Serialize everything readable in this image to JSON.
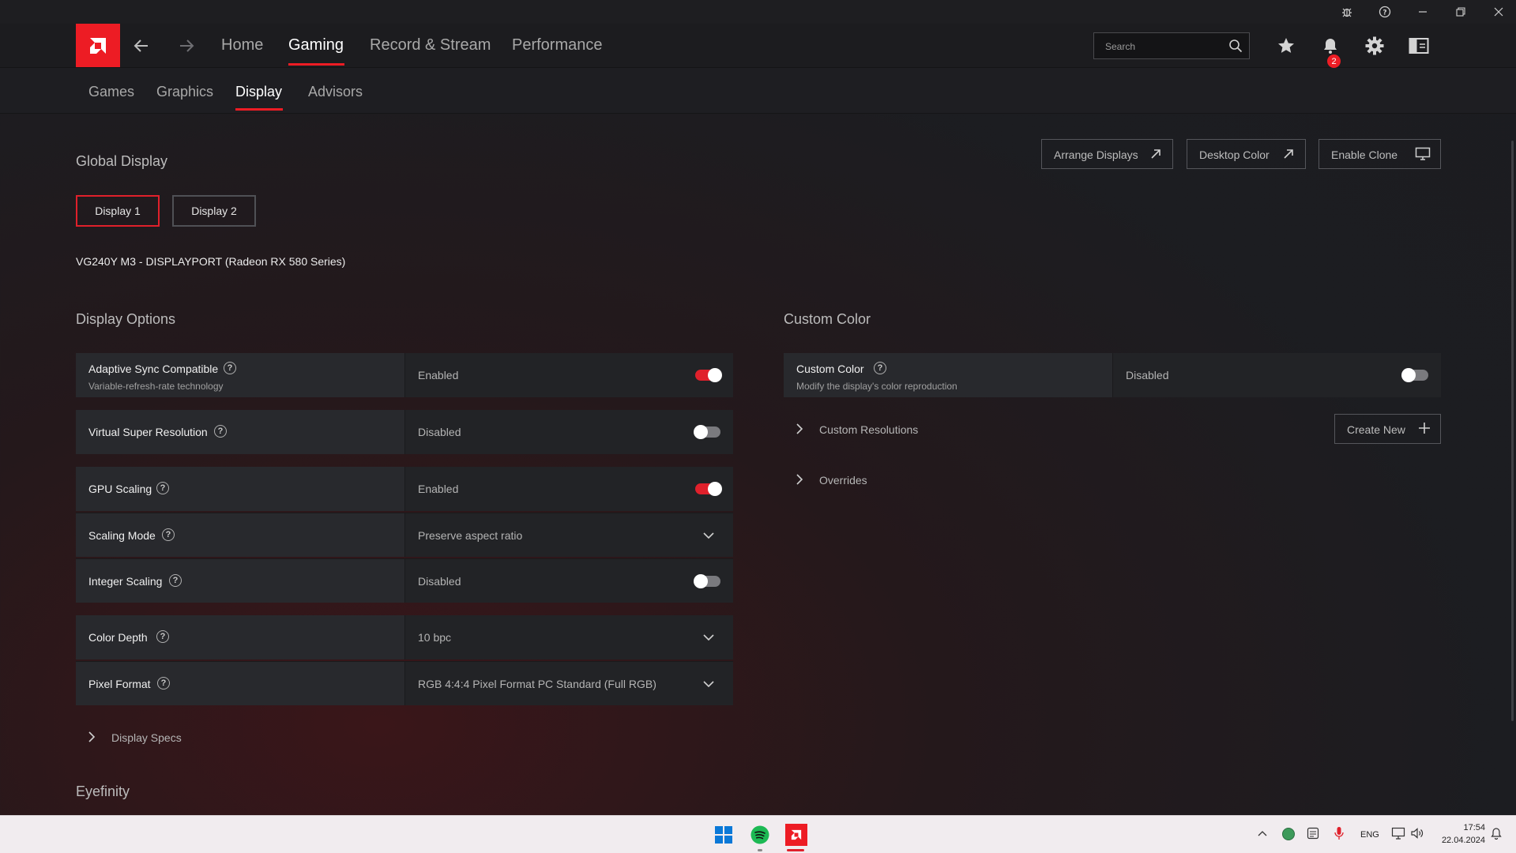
{
  "app": {
    "title_bar_icons": [
      "bug-icon",
      "help-icon",
      "minimize-icon",
      "restore-icon",
      "close-icon"
    ]
  },
  "nav": {
    "back_icon": "arrow-left-icon",
    "forward_icon": "arrow-right-icon",
    "items": [
      {
        "label": "Home",
        "active": false
      },
      {
        "label": "Gaming",
        "active": true
      },
      {
        "label": "Record & Stream",
        "active": false
      },
      {
        "label": "Performance",
        "active": false
      }
    ],
    "search_placeholder": "Search",
    "notification_count": "2",
    "header_icons": [
      "star-icon",
      "bell-icon",
      "gear-icon",
      "sidebar-panel-icon"
    ]
  },
  "subnav": {
    "items": [
      {
        "label": "Games",
        "active": false
      },
      {
        "label": "Graphics",
        "active": false
      },
      {
        "label": "Display",
        "active": true
      },
      {
        "label": "Advisors",
        "active": false
      }
    ]
  },
  "global_display": {
    "title": "Global Display",
    "actions": [
      {
        "label": "Arrange Displays",
        "icon": "external-arrow-icon"
      },
      {
        "label": "Desktop Color",
        "icon": "external-arrow-icon"
      },
      {
        "label": "Enable Clone",
        "icon": "monitor-icon"
      }
    ],
    "display_tabs": [
      {
        "label": "Display 1",
        "active": true
      },
      {
        "label": "Display 2",
        "active": false
      }
    ],
    "monitor_name": "VG240Y M3 - DISPLAYPORT (Radeon RX 580 Series)"
  },
  "display_options": {
    "title": "Display Options",
    "rows": [
      {
        "name": "Adaptive Sync Compatible",
        "desc": "Variable-refresh-rate technology",
        "value": "Enabled",
        "control": "toggle",
        "on": true
      },
      {
        "name": "Virtual Super Resolution",
        "value": "Disabled",
        "control": "toggle",
        "on": false
      },
      {
        "name": "GPU Scaling",
        "value": "Enabled",
        "control": "toggle",
        "on": true
      },
      {
        "name": "Scaling Mode",
        "value": "Preserve aspect ratio",
        "control": "dropdown"
      },
      {
        "name": "Integer Scaling",
        "value": "Disabled",
        "control": "toggle",
        "on": false
      },
      {
        "name": "Color Depth",
        "value": "10 bpc",
        "control": "dropdown"
      },
      {
        "name": "Pixel Format",
        "value": "RGB 4:4:4 Pixel Format PC Standard (Full RGB)",
        "control": "dropdown"
      }
    ],
    "display_specs": "Display Specs"
  },
  "custom_color": {
    "title": "Custom Color",
    "row": {
      "name": "Custom Color",
      "desc": "Modify the display's color reproduction",
      "value": "Disabled",
      "on": false
    },
    "custom_resolutions": "Custom Resolutions",
    "create_new": "Create New",
    "overrides": "Overrides"
  },
  "eyefinity": {
    "title": "Eyefinity"
  },
  "taskbar": {
    "apps": [
      "windows-start-icon",
      "spotify-icon",
      "amd-software-icon"
    ],
    "language": "ENG",
    "time": "17:54",
    "date": "22.04.2024"
  },
  "colors": {
    "accent": "#ed1c24",
    "spotify": "#1db954",
    "windows": "#0a78d7"
  }
}
